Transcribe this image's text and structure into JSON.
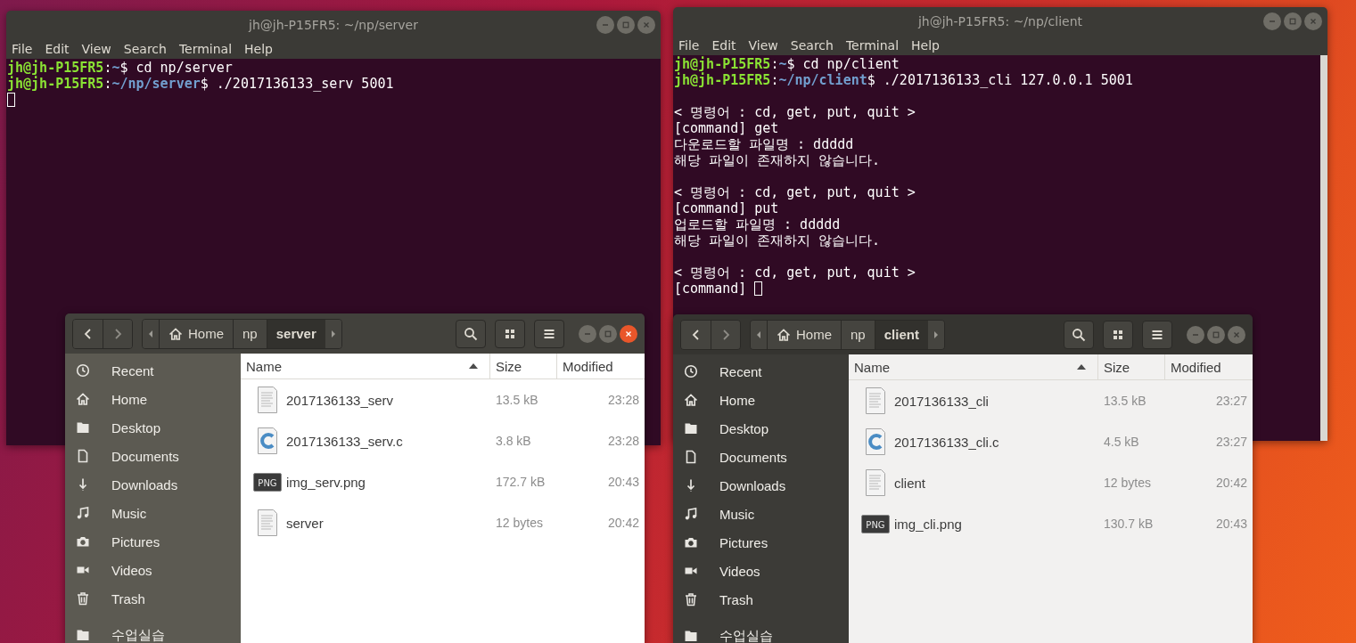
{
  "windows": [
    {
      "kind": "terminal",
      "title": "jh@jh-P15FR5: ~/np/server",
      "focused": false,
      "menu": [
        "File",
        "Edit",
        "View",
        "Search",
        "Terminal",
        "Help"
      ],
      "lines": [
        {
          "segments": [
            {
              "kind": "user",
              "text": "jh@jh-P15FR5"
            },
            {
              "kind": "text",
              "text": ":"
            },
            {
              "kind": "path",
              "text": "~"
            },
            {
              "kind": "text",
              "text": "$ cd np/server"
            }
          ]
        },
        {
          "segments": [
            {
              "kind": "user",
              "text": "jh@jh-P15FR5"
            },
            {
              "kind": "text",
              "text": ":"
            },
            {
              "kind": "path",
              "text": "~/np/server"
            },
            {
              "kind": "text",
              "text": "$ ./2017136133_serv 5001"
            }
          ]
        },
        {
          "cursor": true
        }
      ]
    },
    {
      "kind": "terminal",
      "title": "jh@jh-P15FR5: ~/np/client",
      "focused": false,
      "menu": [
        "File",
        "Edit",
        "View",
        "Search",
        "Terminal",
        "Help"
      ],
      "scrollbar": true,
      "lines": [
        {
          "segments": [
            {
              "kind": "user",
              "text": "jh@jh-P15FR5"
            },
            {
              "kind": "text",
              "text": ":"
            },
            {
              "kind": "path",
              "text": "~"
            },
            {
              "kind": "text",
              "text": "$ cd np/client"
            }
          ]
        },
        {
          "segments": [
            {
              "kind": "user",
              "text": "jh@jh-P15FR5"
            },
            {
              "kind": "text",
              "text": ":"
            },
            {
              "kind": "path",
              "text": "~/np/client"
            },
            {
              "kind": "text",
              "text": "$ ./2017136133_cli 127.0.0.1 5001"
            }
          ]
        },
        {
          "gap_before": true,
          "segments": [
            {
              "kind": "text",
              "text": "< 명령어 : cd, get, put, quit >"
            }
          ]
        },
        {
          "segments": [
            {
              "kind": "text",
              "text": "[command] get"
            }
          ]
        },
        {
          "segments": [
            {
              "kind": "text",
              "text": "다운로드할 파일명 : ddddd"
            }
          ]
        },
        {
          "segments": [
            {
              "kind": "text",
              "text": "해당 파일이 존재하지 않습니다."
            }
          ]
        },
        {
          "gap_before": true,
          "segments": [
            {
              "kind": "text",
              "text": "< 명령어 : cd, get, put, quit >"
            }
          ]
        },
        {
          "segments": [
            {
              "kind": "text",
              "text": "[command] put"
            }
          ]
        },
        {
          "segments": [
            {
              "kind": "text",
              "text": "업로드할 파일명 : ddddd"
            }
          ]
        },
        {
          "segments": [
            {
              "kind": "text",
              "text": "해당 파일이 존재하지 않습니다."
            }
          ]
        },
        {
          "gap_before": true,
          "segments": [
            {
              "kind": "text",
              "text": "< 명령어 : cd, get, put, quit >"
            }
          ]
        },
        {
          "segments": [
            {
              "kind": "text",
              "text": "[command]"
            }
          ],
          "cursor": true
        }
      ]
    },
    {
      "kind": "files",
      "focused": true,
      "path": [
        {
          "label": "Home",
          "selected": false
        },
        {
          "label": "np",
          "selected": false
        },
        {
          "label": "server",
          "selected": true
        }
      ],
      "sidebar": [
        {
          "label": "Recent"
        },
        {
          "label": "Home"
        },
        {
          "label": "Desktop"
        },
        {
          "label": "Documents"
        },
        {
          "label": "Downloads"
        },
        {
          "label": "Music"
        },
        {
          "label": "Pictures"
        },
        {
          "label": "Videos"
        },
        {
          "label": "Trash"
        },
        {
          "label": "수업실습"
        }
      ],
      "columns": [
        {
          "label": "Name",
          "sorted": true
        },
        {
          "label": "Size",
          "sorted": false
        },
        {
          "label": "Modified",
          "sorted": false
        }
      ],
      "files": [
        {
          "kind": "text",
          "name": "2017136133_serv",
          "size": "13.5 kB",
          "modified": "23:28"
        },
        {
          "kind": "c",
          "name": "2017136133_serv.c",
          "size": "3.8 kB",
          "modified": "23:28"
        },
        {
          "kind": "png",
          "icon_text": "PNG",
          "name": "img_serv.png",
          "size": "172.7 kB",
          "modified": "20:43"
        },
        {
          "kind": "text",
          "name": "server",
          "size": "12 bytes",
          "modified": "20:42"
        }
      ]
    },
    {
      "kind": "files",
      "focused": false,
      "path": [
        {
          "label": "Home",
          "selected": false
        },
        {
          "label": "np",
          "selected": false
        },
        {
          "label": "client",
          "selected": true
        }
      ],
      "sidebar": [
        {
          "label": "Recent"
        },
        {
          "label": "Home"
        },
        {
          "label": "Desktop"
        },
        {
          "label": "Documents"
        },
        {
          "label": "Downloads"
        },
        {
          "label": "Music"
        },
        {
          "label": "Pictures"
        },
        {
          "label": "Videos"
        },
        {
          "label": "Trash"
        },
        {
          "label": "수업실습"
        }
      ],
      "columns": [
        {
          "label": "Name",
          "sorted": true
        },
        {
          "label": "Size",
          "sorted": false
        },
        {
          "label": "Modified",
          "sorted": false
        }
      ],
      "files": [
        {
          "kind": "text",
          "name": "2017136133_cli",
          "size": "13.5 kB",
          "modified": "23:27"
        },
        {
          "kind": "c",
          "name": "2017136133_cli.c",
          "size": "4.5 kB",
          "modified": "23:27"
        },
        {
          "kind": "text",
          "name": "client",
          "size": "12 bytes",
          "modified": "20:42"
        },
        {
          "kind": "png",
          "icon_text": "PNG",
          "name": "img_cli.png",
          "size": "130.7 kB",
          "modified": "20:43"
        }
      ]
    }
  ]
}
